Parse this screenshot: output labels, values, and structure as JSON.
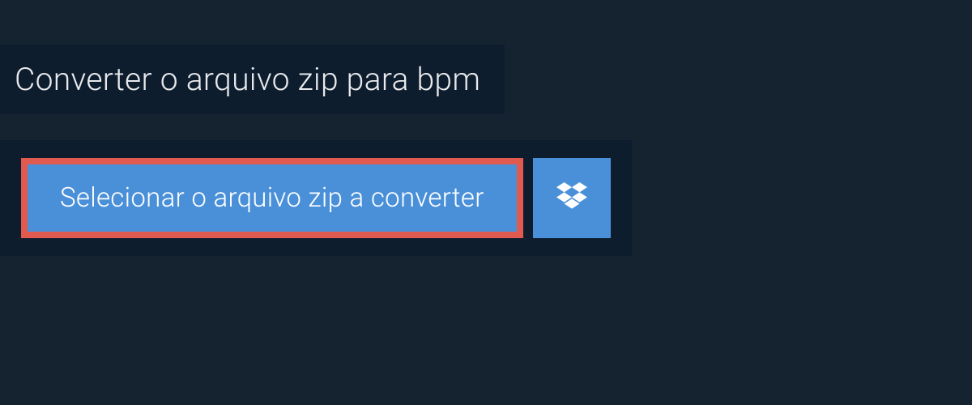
{
  "header": {
    "title": "Converter o arquivo zip para bpm"
  },
  "actions": {
    "select_label": "Selecionar o arquivo zip a converter"
  }
}
